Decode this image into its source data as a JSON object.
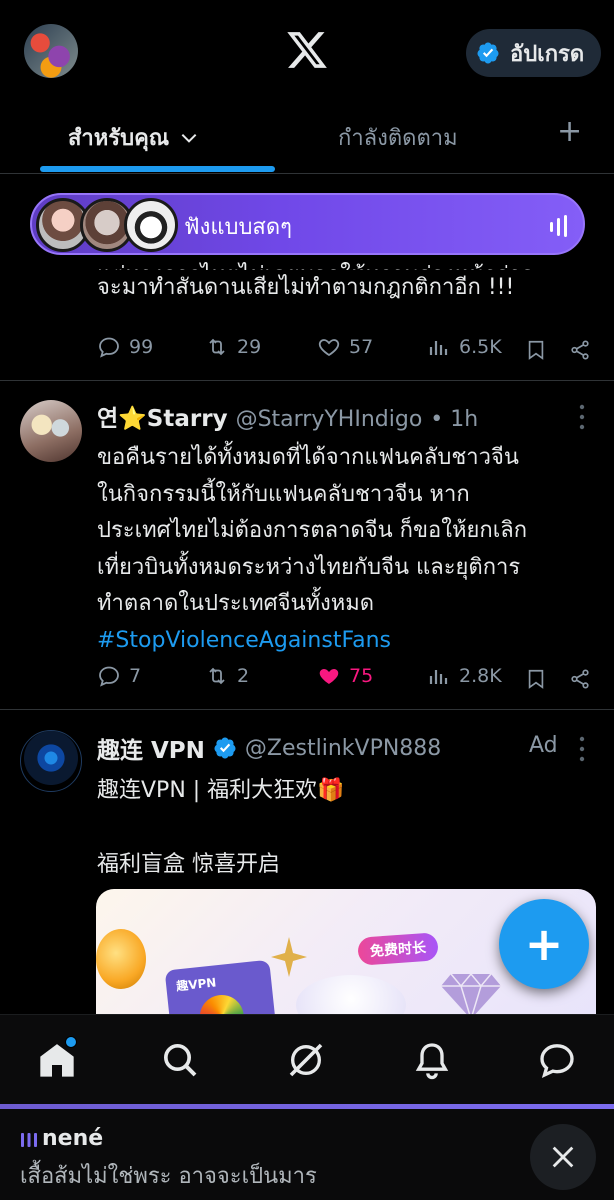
{
  "header": {
    "logo_icon": "x-logo-icon",
    "upgrade_label": "อัปเกรด",
    "verified_color": "#1d9bf0"
  },
  "tabs": {
    "for_you": "สำหรับคุณ",
    "following": "กำลังติดตาม",
    "add_icon": "plus-icon"
  },
  "live": {
    "label": "ฟังแบบสดๆ"
  },
  "tweet1": {
    "text_cut": "แต่ทางการไทยไม่เคยบอกให้ทราบล่วงหน้าว่าจะ",
    "text": "จะมาทำสันดานเสียไม่ทำตามกฎกติกาอีก !!!",
    "replies": "99",
    "retweets": "29",
    "likes": "57",
    "views": "6.5K"
  },
  "tweet2": {
    "name": "연⭐Starry",
    "handle": "@StarryYHIndigo",
    "time": "• 1h",
    "lines": [
      "ขอคืนรายได้ทั้งหมดที่ได้จากแฟนคลับชาวจีน",
      "ในกิจกรรมนี้ให้กับแฟนคลับชาวจีน หาก",
      "ประเทศไทยไม่ต้องการตลาดจีน ก็ขอให้ยกเลิก",
      "เที่ยวบินทั้งหมดระหว่างไทยกับจีน และยุติการ",
      "ทำตลาดในประเทศจีนทั้งหมด"
    ],
    "hashtag": "#StopViolenceAgainstFans",
    "replies": "7",
    "retweets": "2",
    "likes": "75",
    "views": "2.8K",
    "like_color": "#f91880"
  },
  "tweet3": {
    "name": "趣连 VPN",
    "handle": "@ZestlinkVPN888",
    "ad_label": "Ad",
    "line1": "趣连VPN | 福利大狂欢🎁",
    "line2": "福利盲盒 惊喜开启",
    "image_badge": "免费时长",
    "image_card_label": "趣VPN"
  },
  "fab": {
    "label": "+"
  },
  "nav": {
    "items": [
      "home-icon",
      "search-icon",
      "grok-icon",
      "notifications-icon",
      "messages-icon"
    ]
  },
  "player": {
    "title": "nené",
    "subtitle": "เสื้อส้มไม่ใช่พระ อาจจะเป็นมาร"
  }
}
